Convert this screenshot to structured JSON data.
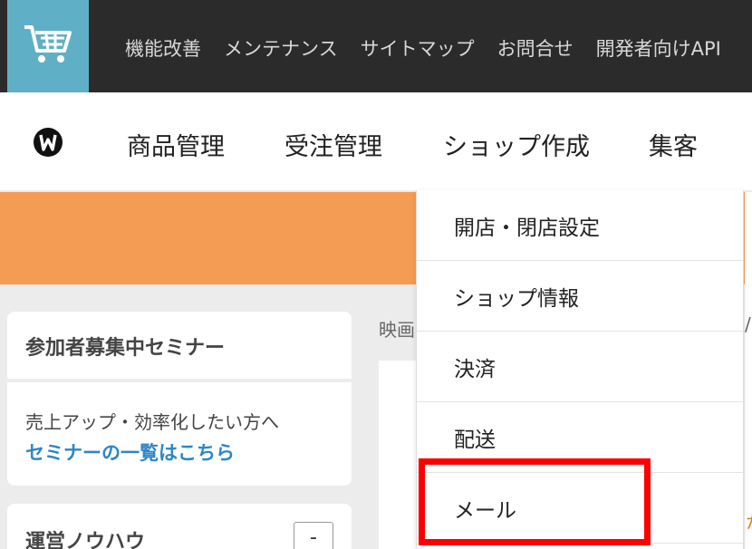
{
  "topbar": {
    "logo_icon": "shopping-cart-icon",
    "links": [
      "機能改善",
      "メンテナンス",
      "サイトマップ",
      "お問合せ",
      "開発者向けAPI"
    ]
  },
  "mainnav": {
    "brand_icon": "brand-logo-icon",
    "items": [
      "商品管理",
      "受注管理",
      "ショップ作成",
      "集客"
    ]
  },
  "seminar_card": {
    "title": "参加者募集中セミナー",
    "text": "売上アップ・効率化したい方へ",
    "link": "セミナーの一覧はこちら"
  },
  "knowhow_card": {
    "title": "運営ノウハウ",
    "toggle": "-"
  },
  "content": {
    "label_fragment": "映画"
  },
  "dropdown": {
    "items": [
      "開店・閉店設定",
      "ショップ情報",
      "決済",
      "配送",
      "メール"
    ],
    "highlighted": "メール"
  },
  "right_fragments": [
    "/",
    "か"
  ],
  "colors": {
    "topbar": "#2b2b2b",
    "logo_bg": "#5fb0c6",
    "banner": "#f49b54",
    "link": "#2d86c6",
    "highlight": "#ff0000"
  }
}
